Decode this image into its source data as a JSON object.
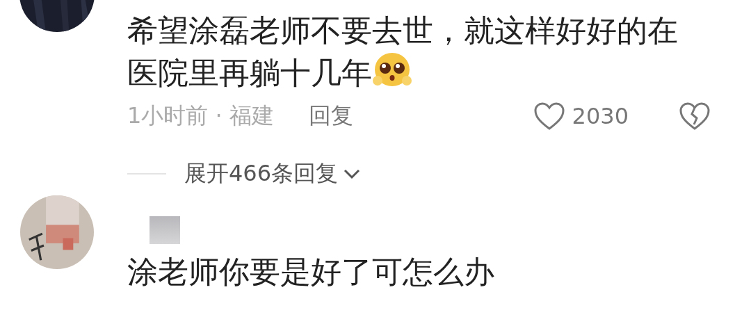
{
  "comments": [
    {
      "avatar": {
        "kind": "dark-picture"
      },
      "text": "希望涂磊老师不要去世，就这样好好的在医院里再躺十几年",
      "has_emoji": true,
      "time": "1小时前 · 福建",
      "reply": "回复",
      "likes": "2030",
      "expand": "展开466条回复"
    },
    {
      "avatar": {
        "kind": "light-picture"
      },
      "username_redacted": true,
      "text": "涂老师你要是好了可怎么办"
    }
  ]
}
